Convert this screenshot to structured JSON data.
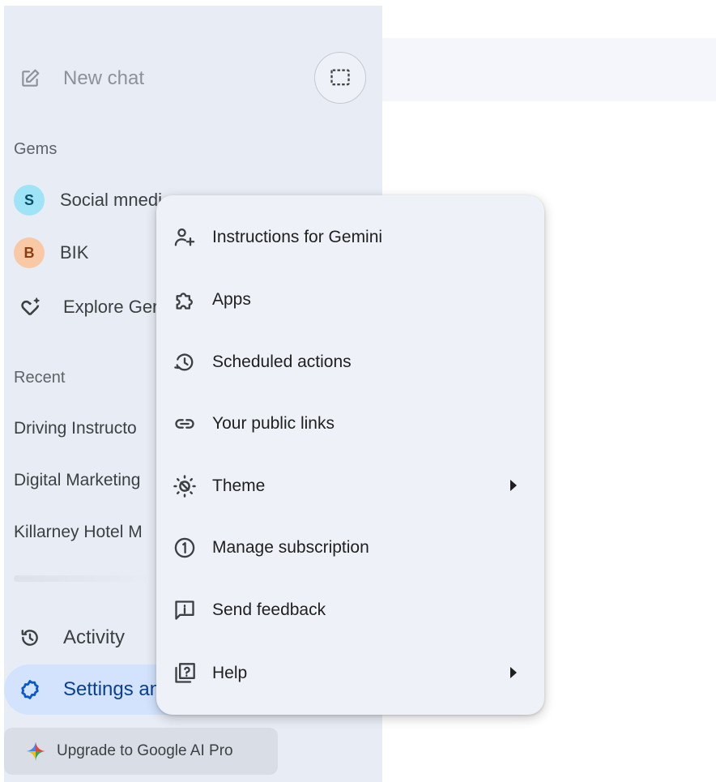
{
  "sidebar": {
    "new_chat": {
      "label": "New chat",
      "icon": "edit-icon"
    },
    "temporary_chat_icon": "temporary-chat-icon",
    "gems_title": "Gems",
    "gems": [
      {
        "initial": "S",
        "label": "Social mnedi",
        "avatar_color": "#9fe3f6",
        "initial_color": "#0a4c63"
      },
      {
        "initial": "B",
        "label": "BIK",
        "avatar_color": "#f9c9a6",
        "initial_color": "#8a3f12"
      },
      {
        "label": "Explore Ger",
        "icon": "gem-spark-icon"
      }
    ],
    "recent_title": "Recent",
    "recent": [
      "Driving Instructo",
      "Digital Marketing",
      "Killarney Hotel M"
    ],
    "activity": {
      "label": "Activity",
      "icon": "history-icon"
    },
    "settings": {
      "label": "Settings and help",
      "icon": "settings-icon"
    },
    "upgrade": {
      "label": "Upgrade to Google AI Pro",
      "icon": "gemini-spark-icon"
    }
  },
  "menu": {
    "items": [
      {
        "label": "Instructions for Gemini",
        "icon": "person-spark-icon",
        "submenu": false
      },
      {
        "label": "Apps",
        "icon": "puzzle-icon",
        "submenu": false
      },
      {
        "label": "Scheduled actions",
        "icon": "schedule-icon",
        "submenu": false
      },
      {
        "label": "Your public links",
        "icon": "link-icon",
        "submenu": false
      },
      {
        "label": "Theme",
        "icon": "theme-icon",
        "submenu": true
      },
      {
        "label": "Manage subscription",
        "icon": "subscription-icon",
        "submenu": false
      },
      {
        "label": "Send feedback",
        "icon": "feedback-icon",
        "submenu": false
      },
      {
        "label": "Help",
        "icon": "help-icon",
        "submenu": true
      }
    ]
  },
  "colors": {
    "sidebar_bg": "#e8ecf4",
    "menu_bg": "#eef1f7",
    "settings_active_bg": "#d3e3fd",
    "settings_active_text": "#0b3f8f"
  }
}
